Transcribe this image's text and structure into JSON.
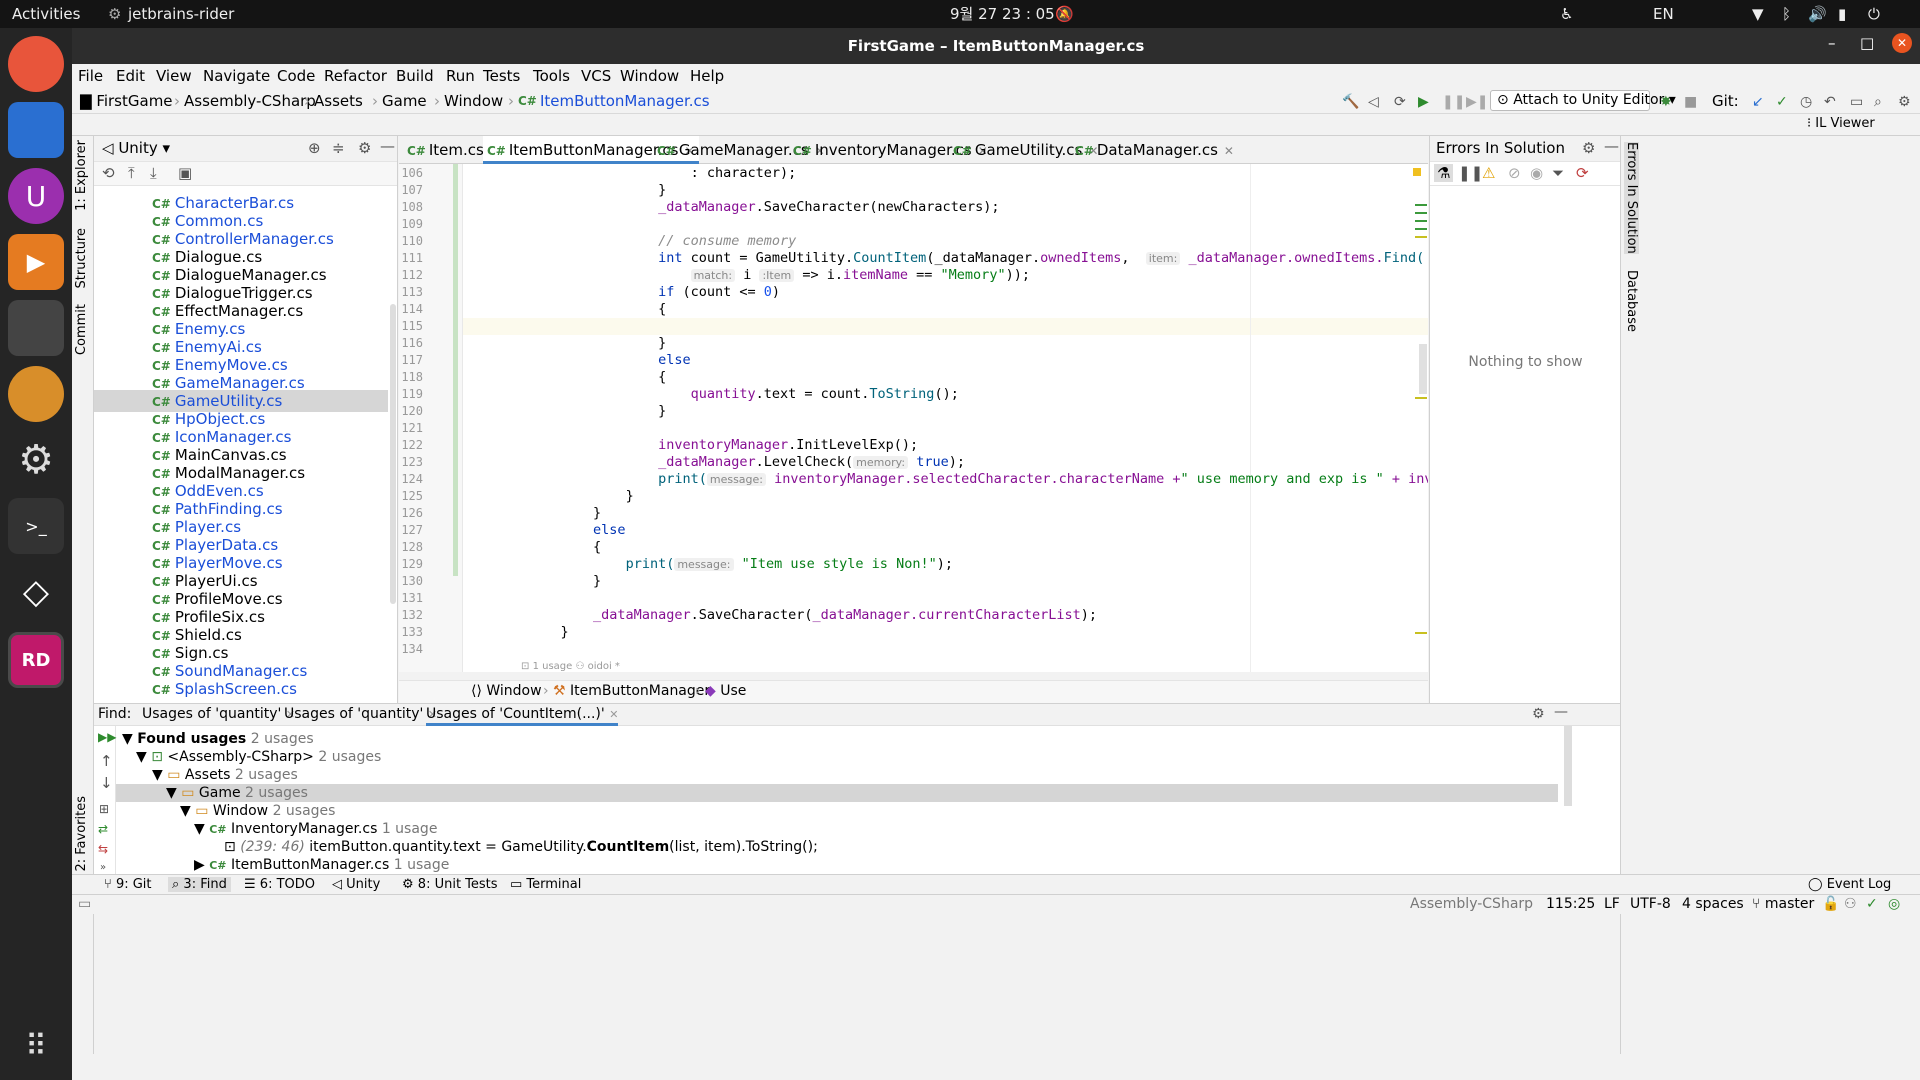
{
  "system": {
    "activities": "Activities",
    "app_name": "jetbrains-rider",
    "clock": "9월 27  23 : 05",
    "lang": "EN"
  },
  "window": {
    "title": "FirstGame – ItemButtonManager.cs"
  },
  "menu": [
    "File",
    "Edit",
    "View",
    "Navigate",
    "Code",
    "Refactor",
    "Build",
    "Run",
    "Tests",
    "Tools",
    "VCS",
    "Window",
    "Help"
  ],
  "breadcrumbs": [
    "FirstGame",
    "Assembly-CSharp",
    "Assets",
    "Game",
    "Window",
    "ItemButtonManager.cs"
  ],
  "toolbar": {
    "run_config": "Attach to Unity Editor",
    "git_label": "Git:",
    "il_viewer": "IL Viewer"
  },
  "left_tools": [
    "1: Explorer",
    "Structure",
    "Commit",
    "2: Favorites"
  ],
  "project": {
    "title": "Unity",
    "files": [
      "CharacterBar.cs",
      "Common.cs",
      "ControllerManager.cs",
      "Dialogue.cs",
      "DialogueManager.cs",
      "DialogueTrigger.cs",
      "EffectManager.cs",
      "Enemy.cs",
      "EnemyAi.cs",
      "EnemyMove.cs",
      "GameManager.cs",
      "GameUtility.cs",
      "HpObject.cs",
      "IconManager.cs",
      "MainCanvas.cs",
      "ModalManager.cs",
      "OddEven.cs",
      "PathFinding.cs",
      "Player.cs",
      "PlayerData.cs",
      "PlayerMove.cs",
      "PlayerUi.cs",
      "ProfileMove.cs",
      "ProfileSix.cs",
      "Shield.cs",
      "Sign.cs",
      "SoundManager.cs",
      "SplashScreen.cs"
    ],
    "selected": "GameUtility.cs"
  },
  "tabs": [
    "Item.cs",
    "ItemButtonManager.cs",
    "GameManager.cs",
    "InventoryManager.cs",
    "GameUtility.cs",
    "DataManager.cs"
  ],
  "active_tab": "ItemButtonManager.cs",
  "cs_badge": "C#",
  "line_numbers": [
    "106",
    "107",
    "108",
    "109",
    "110",
    "111",
    "112",
    "113",
    "114",
    "115",
    "116",
    "117",
    "118",
    "119",
    "120",
    "121",
    "122",
    "123",
    "124",
    "125",
    "126",
    "127",
    "128",
    "129",
    "130",
    "131",
    "132",
    "133",
    "134"
  ],
  "code": {
    "l106": ": character);",
    "l108a": "_dataManager",
    "l108b": ".SaveCharacter(newCharacters);",
    "l110": "// consume memory",
    "l111a": "int",
    "l111b": " count = GameUtility.",
    "l111c": "CountItem",
    "l111d": "(_dataManager.",
    "l111e": "ownedItems",
    ", ": "",
    "l111f": "item:",
    "l111g": "_dataManager.ownedItems.",
    "l111h": "Find(",
    "l112a": "match:",
    "l112b": " i ",
    "l112c": ":Item",
    "l112d": " => i.",
    "l112e": "itemName",
    "l112f": " == ",
    "l112g": "\"Memory\"",
    "l112h": "));",
    "l113a": "if",
    "l113b": " (count <= ",
    "l113c": "0",
    "l113d": ")",
    "brace_open": "{",
    "brace_close": "}",
    "else": "else",
    "l119a": "quantity",
    "l119b": ".text = count.",
    "l119c": "ToString",
    "l119d": "();",
    "l122a": "inventoryManager",
    "l122b": ".InitLevelExp();",
    "l123a": "_dataManager",
    "l123b": ".LevelCheck(",
    "l123c": "memory:",
    "l123d": "true",
    "l123e": ");",
    "l124a": "print(",
    "l124b": "message:",
    "l124c": "inventoryManager.selectedCharacter.characterName +",
    "l124d": "\" use memory and exp is \"",
    "l124e": " + inventoryManager.selectedCharacter.",
    "l129a": "print(",
    "l129b": "message:",
    "l129c": "\"Item use style is Non!\"",
    "l129d": ");",
    "l132a": "_dataManager",
    "l132b": ".SaveCharacter(",
    "l132c": "_dataManager.currentCharacterList",
    "l132d": ");",
    "usage_hint": "1 usage",
    "author_hint": "oidoi *"
  },
  "editor_breadcrumb": [
    "Window",
    "ItemButtonManager",
    "Use"
  ],
  "errors_panel": {
    "title": "Errors In Solution",
    "empty": "Nothing to show"
  },
  "right_tools": [
    "Errors In Solution",
    "Database"
  ],
  "find": {
    "label": "Find:",
    "tabs": [
      "Usages of 'quantity'",
      "Usages of 'quantity'",
      "Usages of 'CountItem(...)'"
    ],
    "tree": {
      "found": "Found usages",
      "found_count": "2 usages",
      "assembly": "<Assembly-CSharp>",
      "assembly_count": "2 usages",
      "assets": "Assets",
      "assets_count": "2 usages",
      "game": "Game",
      "game_count": "2 usages",
      "window": "Window",
      "window_count": "2 usages",
      "inv": "InventoryManager.cs",
      "inv_count": "1 usage",
      "usage_loc": "(239: 46)",
      "usage_a": "itemButton.quantity.text = GameUtility.",
      "usage_b": "CountItem",
      "usage_c": "(list, item).ToString();",
      "itembtn": "ItemButtonManager.cs",
      "itembtn_count": "1 usage"
    }
  },
  "bottom_tools": [
    "9: Git",
    "3: Find",
    "6: TODO",
    "Unity",
    "8: Unit Tests",
    "Terminal",
    "Event Log"
  ],
  "status": {
    "context": "Assembly-CSharp",
    "position": "115:25",
    "line_sep": "LF",
    "encoding": "UTF-8",
    "indent": "4 spaces",
    "branch": "master"
  },
  "colors": {
    "dock": "#252525",
    "titlebar": "#2d2d2d",
    "accent": "#1a4ed8"
  }
}
